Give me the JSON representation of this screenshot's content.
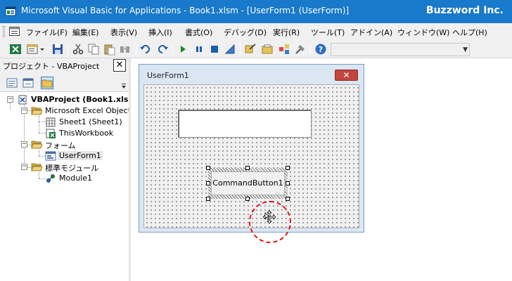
{
  "titlebar": {
    "title": "Microsoft Visual Basic for Applications - Book1.xlsm - [UserForm1 (UserForm)]",
    "brand": "Buzzword Inc."
  },
  "menu": {
    "items": [
      "ファイル(F)",
      "編集(E)",
      "表示(V)",
      "挿入(I)",
      "書式(O)",
      "デバッグ(D)",
      "実行(R)",
      "ツール(T)",
      "アドイン(A)",
      "ウィンドウ(W)",
      "ヘルプ(H)"
    ]
  },
  "project": {
    "title": "プロジェクト - VBAProject",
    "close_label": "✕",
    "tree": {
      "root": "VBAProject (Book1.xls",
      "excel_objects": "Microsoft Excel Object",
      "sheet1": "Sheet1 (Sheet1)",
      "thisworkbook": "ThisWorkbook",
      "forms": "フォーム",
      "userform1": "UserForm1",
      "modules": "標準モジュール",
      "module1": "Module1"
    }
  },
  "userform": {
    "title": "UserForm1",
    "close_label": "✕",
    "button_caption": "CommandButton1"
  },
  "colors": {
    "titlebar": "#1979ca",
    "highlight": "#e5161a"
  }
}
